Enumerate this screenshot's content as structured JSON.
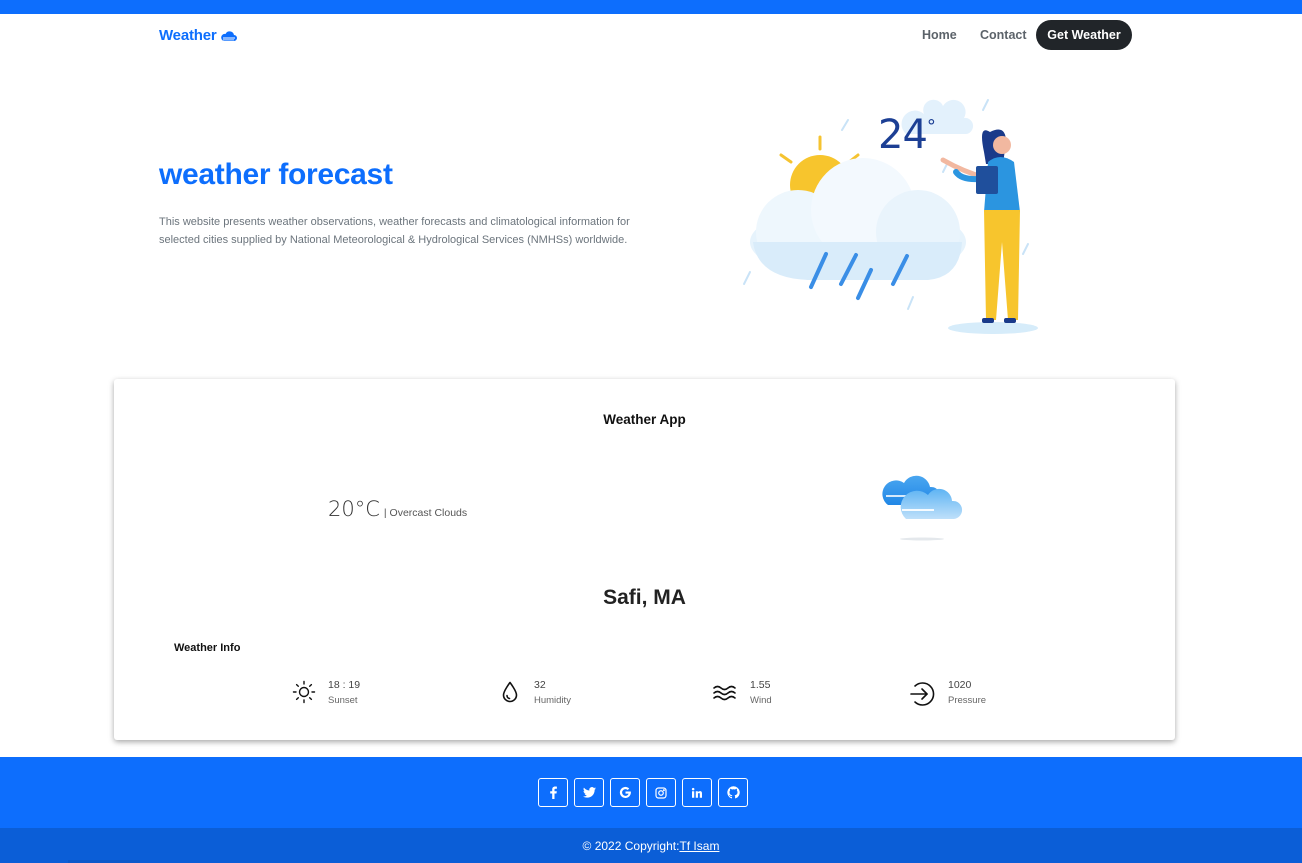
{
  "nav": {
    "brand": "Weather",
    "brand_icon": "cloud-icon",
    "links": [
      "Home",
      "Contact"
    ],
    "cta": "Get Weather"
  },
  "hero": {
    "title": "weather forecast",
    "description": "This website presents weather observations, weather forecasts and climatological information for selected cities supplied by National Meteorological & Hydrological Services (NMHSs) worldwide.",
    "illustration_temp": "24",
    "illustration_unit": "°"
  },
  "card": {
    "title": "Weather App",
    "temperature": "20°C",
    "description": "| Overcast Clouds",
    "condition_icon": "overcast-clouds-icon",
    "city": "Safi, MA",
    "info_title": "Weather Info",
    "stats": [
      {
        "value": "18 : 19",
        "label": "Sunset",
        "icon": "sun-icon"
      },
      {
        "value": "32",
        "label": "Humidity",
        "icon": "droplet-icon"
      },
      {
        "value": "1.55",
        "label": "Wind",
        "icon": "wind-icon"
      },
      {
        "value": "1020",
        "label": "Pressure",
        "icon": "pressure-icon"
      }
    ]
  },
  "footer": {
    "socials": [
      "facebook-icon",
      "twitter-icon",
      "google-icon",
      "instagram-icon",
      "linkedin-icon",
      "github-icon"
    ],
    "copyright": "© 2022 Copyright:",
    "author": "Tf Isam"
  },
  "colors": {
    "primary": "#0d6efd",
    "footer_bottom": "#0b5ed7",
    "dark_button": "#212529"
  }
}
